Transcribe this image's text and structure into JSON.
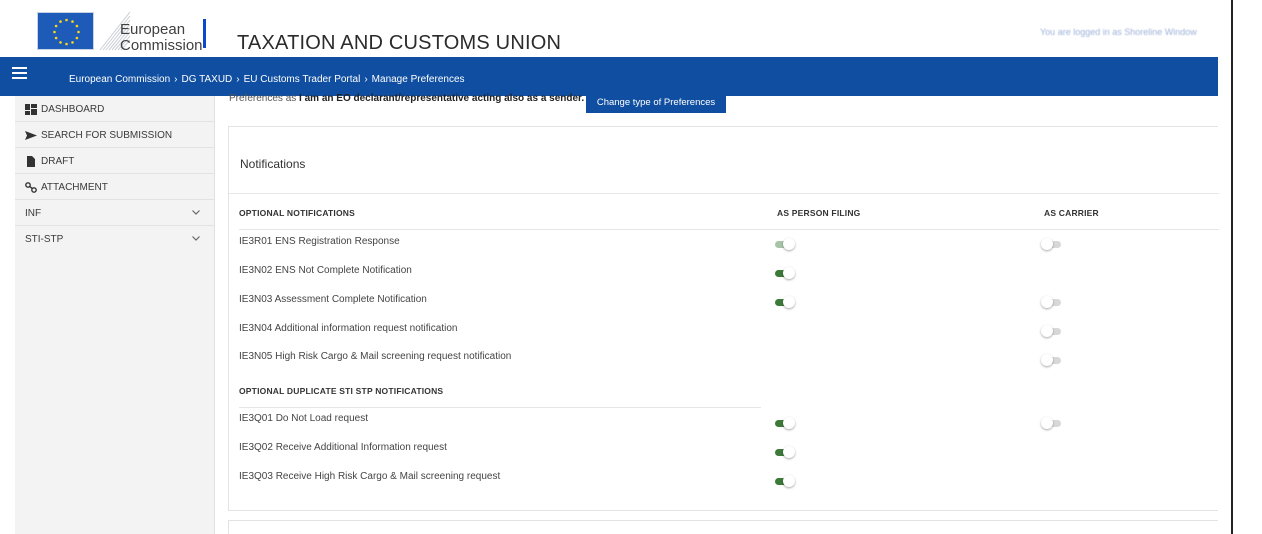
{
  "header": {
    "logo_line1": "European",
    "logo_line2": "Commission",
    "site_title": "TAXATION AND CUSTOMS UNION",
    "logged_in": "You are logged in as Shoreline Window"
  },
  "breadcrumb": {
    "items": [
      "European Commission",
      "DG TAXUD",
      "EU Customs Trader Portal",
      "Manage Preferences"
    ]
  },
  "sidebar": {
    "items": [
      {
        "label": "DASHBOARD",
        "icon": "dashboard-icon"
      },
      {
        "label": "SEARCH FOR SUBMISSION",
        "icon": "send-icon"
      },
      {
        "label": "DRAFT",
        "icon": "document-icon"
      },
      {
        "label": "ATTACHMENT",
        "icon": "attachment-icon"
      },
      {
        "label": "INF",
        "icon": "chevron-down-icon"
      },
      {
        "label": "STI-STP",
        "icon": "chevron-down-icon"
      }
    ]
  },
  "preferences": {
    "prefix": "Preferences as",
    "role": "I am an EO declarant/representative acting also as a sender.",
    "change_button": "Change type of Preferences"
  },
  "notifications": {
    "title": "Notifications",
    "columns": {
      "optional": "OPTIONAL NOTIFICATIONS",
      "person_filing": "AS PERSON FILING",
      "carrier": "AS CARRIER"
    },
    "rows": [
      {
        "label": "IE3R01 ENS Registration Response",
        "person_filing": "on-disabled",
        "carrier": "off"
      },
      {
        "label": "IE3N02 ENS Not Complete Notification",
        "person_filing": "on",
        "carrier": "none"
      },
      {
        "label": "IE3N03 Assessment Complete Notification",
        "person_filing": "on",
        "carrier": "off"
      },
      {
        "label": "IE3N04 Additional information request notification",
        "person_filing": "none",
        "carrier": "off"
      },
      {
        "label": "IE3N05 High Risk Cargo & Mail screening request notification",
        "person_filing": "none",
        "carrier": "off"
      }
    ],
    "duplicate_heading": "OPTIONAL DUPLICATE STI STP NOTIFICATIONS",
    "duplicate_rows": [
      {
        "label": "IE3Q01 Do Not Load request",
        "person_filing": "on",
        "carrier": "off"
      },
      {
        "label": "IE3Q02 Receive Additional Information request",
        "person_filing": "on",
        "carrier": "none"
      },
      {
        "label": "IE3Q03 Receive High Risk Cargo & Mail screening request",
        "person_filing": "on",
        "carrier": "none"
      }
    ]
  },
  "colors": {
    "brand_blue": "#0f4ea0",
    "toggle_on": "#3d7a3a",
    "toggle_off": "#d8d8d8"
  }
}
